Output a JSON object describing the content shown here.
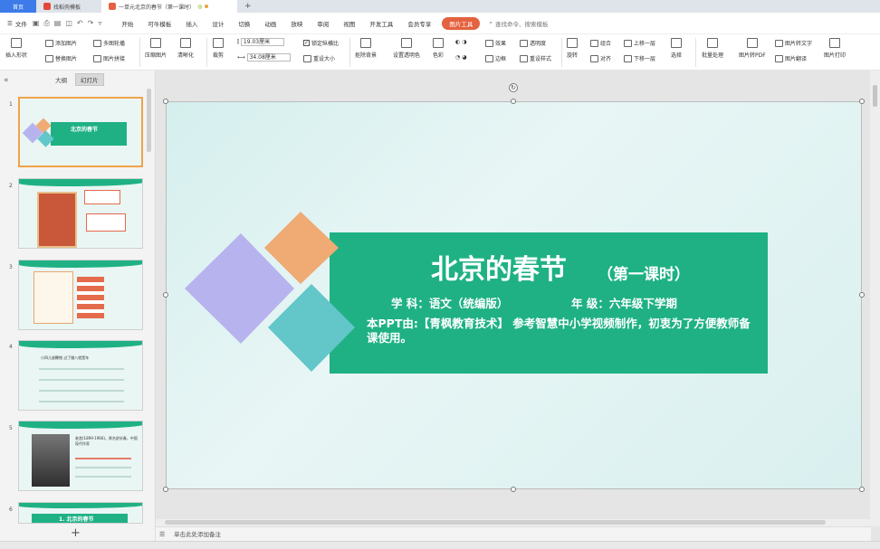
{
  "tabs": {
    "home": "首页",
    "template": "找稻壳模板",
    "document": "一单元北京的春节（第一课时）"
  },
  "menu": {
    "file": "文件",
    "items": [
      "开始",
      "可牛模板",
      "插入",
      "设计",
      "切换",
      "动画",
      "放映",
      "审阅",
      "视图",
      "开发工具",
      "会员专享"
    ],
    "picture_tool": "图片工具",
    "search_placeholder": "查找命令、搜索模板"
  },
  "ribbon": {
    "insert_shape": "插入形状",
    "add_picture": "添加图片",
    "replace_picture": "替换图片",
    "multi_picture": "多图轮播",
    "picture_stitch": "图片拼接",
    "compress": "压缩图片",
    "clarity": "清晰化",
    "crop": "裁剪",
    "width_value": "19.03厘米",
    "height_value": "34.08厘米",
    "lock_ratio": "锁定纵横比",
    "reset_size": "重设大小",
    "matting": "抠除背景",
    "transparent_color": "设置透明色",
    "color": "色彩",
    "effects": "效果",
    "border": "边框",
    "transparency": "透明度",
    "reset_style": "重设样式",
    "rotate": "旋转",
    "group": "组合",
    "align": "对齐",
    "bring_forward": "上移一层",
    "send_backward": "下移一层",
    "select": "选择",
    "batch": "批量处理",
    "to_pdf": "图片转PDF",
    "to_text": "图片转文字",
    "translate": "图片翻译",
    "print": "图片打印"
  },
  "pane": {
    "outline_tab": "大纲",
    "slides_tab": "幻灯片",
    "slide_numbers": [
      "1",
      "2",
      "3",
      "4",
      "5",
      "6"
    ],
    "slide6_title": "1. 北京的春节",
    "slide5_text": "老舍(1899-1966)，原名舒庆春，中国现代作家",
    "slide4_text": "小四儿放鞭炮 过了腊八就是年"
  },
  "slide": {
    "title": "北京的春节",
    "subtitle": "（第一课时）",
    "subject": "学  科：语文（统编版）",
    "grade": "年  级：六年级下学期",
    "description": "本PPT由:【青枫教育技术】 参考智慧中小学视频制作，初衷为了方便教师备课使用。"
  },
  "notes_placeholder": "单击此处添加备注",
  "colors": {
    "banner": "#1fb184",
    "diamond_purple": "#b7b3ee",
    "diamond_orange": "#f0aa73",
    "diamond_teal": "#63c6c9",
    "picture_tool": "#e4623f"
  }
}
